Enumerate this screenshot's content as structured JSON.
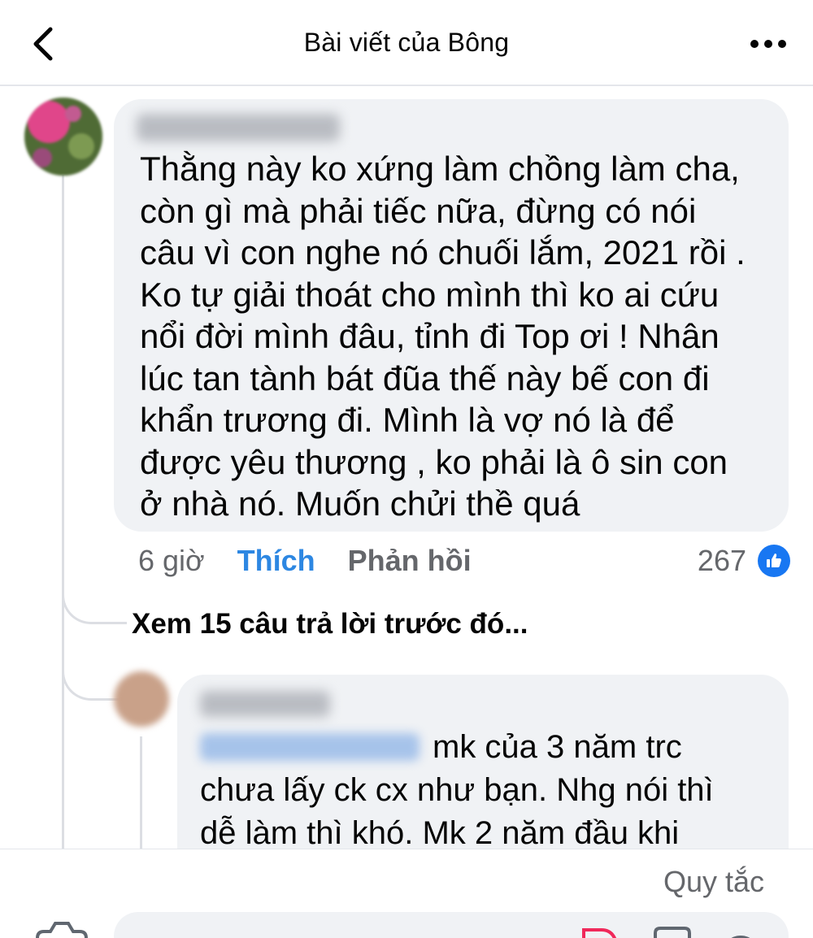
{
  "header": {
    "title": "Bài viết của Bông",
    "back_icon": "chevron-left-icon",
    "more_icon": "more-horizontal-icon"
  },
  "comment": {
    "text": "Thằng này ko xứng làm chồng làm cha,\ncòn gì mà phải tiếc nữa, đừng có nói\ncâu vì con nghe nó chuối lắm, 2021 rồi .\nKo tự giải thoát cho mình thì ko ai cứu\nnổi đời mình đâu, tỉnh đi Top ơi ! Nhân\nlúc tan tành bát đũa thế này bế con đi\nkhẩn trương đi. Mình là vợ nó là để\nđược yêu thương , ko phải là ô sin con\nở nhà nó. Muốn chửi thề quá",
    "time": "6 giờ",
    "like_label": "Thích",
    "reply_label": "Phản hồi",
    "reaction_count": "267",
    "reaction_icon": "like-thumb-icon"
  },
  "view_previous": "Xem 15 câu trả lời trước đó...",
  "reply": {
    "text": "mk của 3 năm trc\nchưa lấy ck cx như bạn. Nhg nói thì\ndễ làm thì khó. Mk 2 năm đầu khi"
  },
  "footer": {
    "rules_label": "Quy tắc"
  },
  "colors": {
    "accent_blue": "#2d87e2",
    "bubble_bg": "#f0f2f5",
    "secondary_text": "#65676b"
  }
}
